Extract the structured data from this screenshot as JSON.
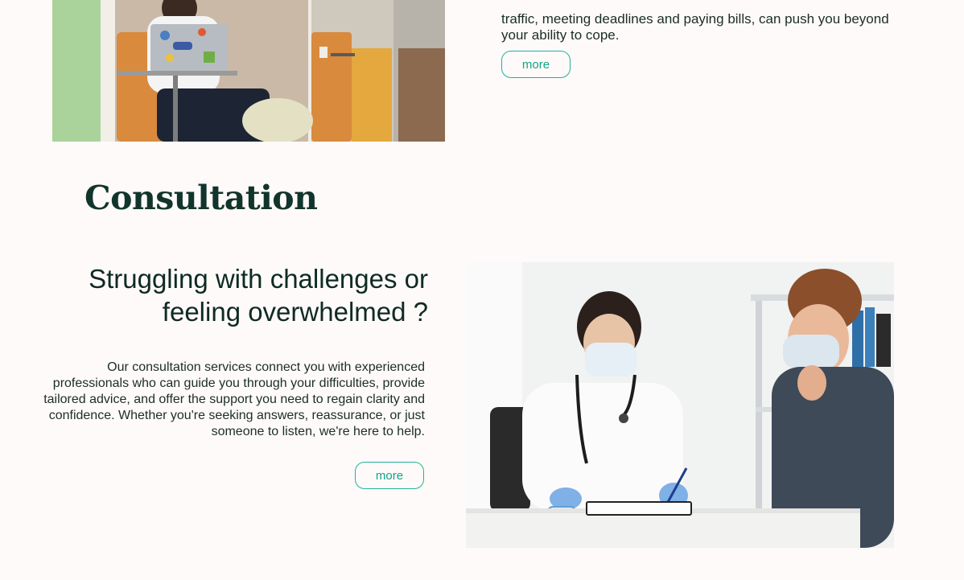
{
  "previous_section": {
    "text": "traffic, meeting deadlines and paying bills, can push you beyond your ability to cope.",
    "more_label": "more",
    "image_alt": "Stressed man at laptop"
  },
  "consultation": {
    "title": "Consultation",
    "headline": "Struggling with challenges or feeling overwhelmed ?",
    "body": "Our consultation services connect you with experienced professionals who can guide you through your difficulties, provide tailored advice, and offer the support you need to regain clarity and confidence. Whether you're seeking answers, reassurance, or just someone to listen, we're here to help.",
    "more_label": "more",
    "image_alt": "Doctor consulting a patient"
  },
  "colors": {
    "background": "#fefaf9",
    "accent": "#1fb39a",
    "heading": "#11352c"
  }
}
